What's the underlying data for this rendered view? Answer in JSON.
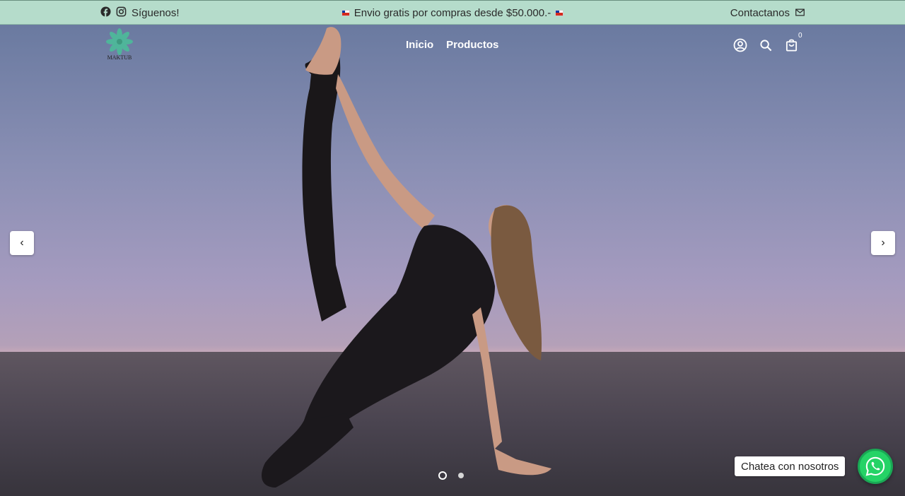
{
  "topbar": {
    "follow_label": "Síguenos!",
    "promo_text": "Envio gratis por compras desde $50.000.-",
    "contact_label": "Contactanos"
  },
  "header": {
    "logo_text": "MAKTUB",
    "nav": [
      {
        "label": "Inicio"
      },
      {
        "label": "Productos"
      }
    ],
    "cart_count": "0"
  },
  "slider": {
    "prev_label": "‹",
    "next_label": "›",
    "slides_total": 2,
    "active_slide": 1
  },
  "chat": {
    "label": "Chatea con nosotros"
  },
  "colors": {
    "topbar_bg": "#b5dccb",
    "whatsapp": "#25d366",
    "logo_green": "#4fb59a"
  },
  "icons": [
    "facebook-icon",
    "instagram-icon",
    "chile-flag-icon",
    "mail-icon",
    "account-icon",
    "search-icon",
    "cart-icon",
    "whatsapp-icon"
  ]
}
